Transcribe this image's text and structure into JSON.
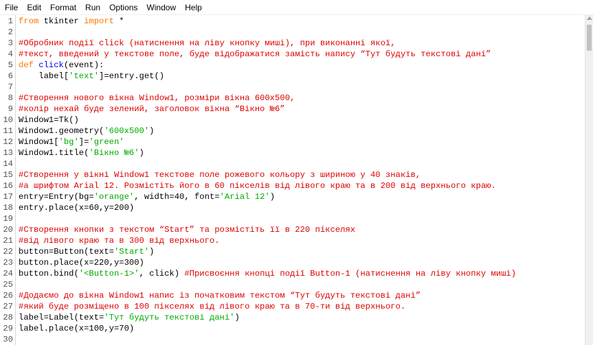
{
  "menu": [
    "File",
    "Edit",
    "Format",
    "Run",
    "Options",
    "Window",
    "Help"
  ],
  "colors": {
    "keyword": "#ff7700",
    "string": "#00aa00",
    "comment": "#dd0000",
    "function_name": "#0000ff",
    "text": "#000000",
    "line_number": "#555555"
  },
  "lines": [
    [
      {
        "k": "kw",
        "t": "from"
      },
      {
        "k": "n",
        "t": " tkinter "
      },
      {
        "k": "kw",
        "t": "import"
      },
      {
        "k": "n",
        "t": " *"
      }
    ],
    [],
    [
      {
        "k": "com",
        "t": "#Обробник події click (натиснення на ліву кнопку миші), при виконанні якої,"
      }
    ],
    [
      {
        "k": "com",
        "t": "#текст, введений у текстове поле, буде відображатися замість напису “Тут будуть текстові дані”"
      }
    ],
    [
      {
        "k": "kw",
        "t": "def"
      },
      {
        "k": "n",
        "t": " "
      },
      {
        "k": "func",
        "t": "click"
      },
      {
        "k": "n",
        "t": "(event):"
      }
    ],
    [
      {
        "k": "n",
        "t": "    label["
      },
      {
        "k": "str",
        "t": "'text'"
      },
      {
        "k": "n",
        "t": "]=entry.get()"
      }
    ],
    [],
    [
      {
        "k": "com",
        "t": "#Створення нового вікна Window1, розміри вікна 600x500,"
      }
    ],
    [
      {
        "k": "com",
        "t": "#колір нехай буде зелений, заголовок вікна “Вікно №6”"
      }
    ],
    [
      {
        "k": "n",
        "t": "Window1=Tk()"
      }
    ],
    [
      {
        "k": "n",
        "t": "Window1.geometry("
      },
      {
        "k": "str",
        "t": "'600x500'"
      },
      {
        "k": "n",
        "t": ")"
      }
    ],
    [
      {
        "k": "n",
        "t": "Window1["
      },
      {
        "k": "str",
        "t": "'bg'"
      },
      {
        "k": "n",
        "t": "]="
      },
      {
        "k": "str",
        "t": "'green'"
      }
    ],
    [
      {
        "k": "n",
        "t": "Window1.title("
      },
      {
        "k": "str",
        "t": "'Вікно №6'"
      },
      {
        "k": "n",
        "t": ")"
      }
    ],
    [],
    [
      {
        "k": "com",
        "t": "#Створення у вікні Window1 текстове поле рожевого кольору з шириною у 40 знаків,"
      }
    ],
    [
      {
        "k": "com",
        "t": "#а шрифтом Arial 12. Розмістіть його в 60 пікселів від лівого краю та в 200 від верхнього краю."
      }
    ],
    [
      {
        "k": "n",
        "t": "entry=Entry(bg="
      },
      {
        "k": "str",
        "t": "'orange'"
      },
      {
        "k": "n",
        "t": ", width=40, font="
      },
      {
        "k": "str",
        "t": "'Arial 12'"
      },
      {
        "k": "n",
        "t": ")"
      }
    ],
    [
      {
        "k": "n",
        "t": "entry.place(x=60,y=200)"
      }
    ],
    [],
    [
      {
        "k": "com",
        "t": "#Створення кнопки з текстом “Start” та розмістіть її в 220 пікселях"
      }
    ],
    [
      {
        "k": "com",
        "t": "#від лівого краю та в 300 від верхнього."
      }
    ],
    [
      {
        "k": "n",
        "t": "button=Button(text="
      },
      {
        "k": "str",
        "t": "'Start'"
      },
      {
        "k": "n",
        "t": ")"
      }
    ],
    [
      {
        "k": "n",
        "t": "button.place(x=220,y=300)"
      }
    ],
    [
      {
        "k": "n",
        "t": "button.bind("
      },
      {
        "k": "str",
        "t": "'<Button-1>'"
      },
      {
        "k": "n",
        "t": ", click) "
      },
      {
        "k": "com",
        "t": "#Присвоєння кнопці події Button-1 (натиснення на ліву кнопку миші)"
      }
    ],
    [],
    [
      {
        "k": "com",
        "t": "#Додаємо до вікна Window1 напис із початковим текстом “Тут будуть текстові дані”"
      }
    ],
    [
      {
        "k": "com",
        "t": "#який буде розміщено в 100 пікселях від лівого краю та в 70-ти від верхнього."
      }
    ],
    [
      {
        "k": "n",
        "t": "label=Label(text="
      },
      {
        "k": "str",
        "t": "'Тут будуть текстові дані'"
      },
      {
        "k": "n",
        "t": ")"
      }
    ],
    [
      {
        "k": "n",
        "t": "label.place(x=100,y=70)"
      }
    ],
    []
  ]
}
